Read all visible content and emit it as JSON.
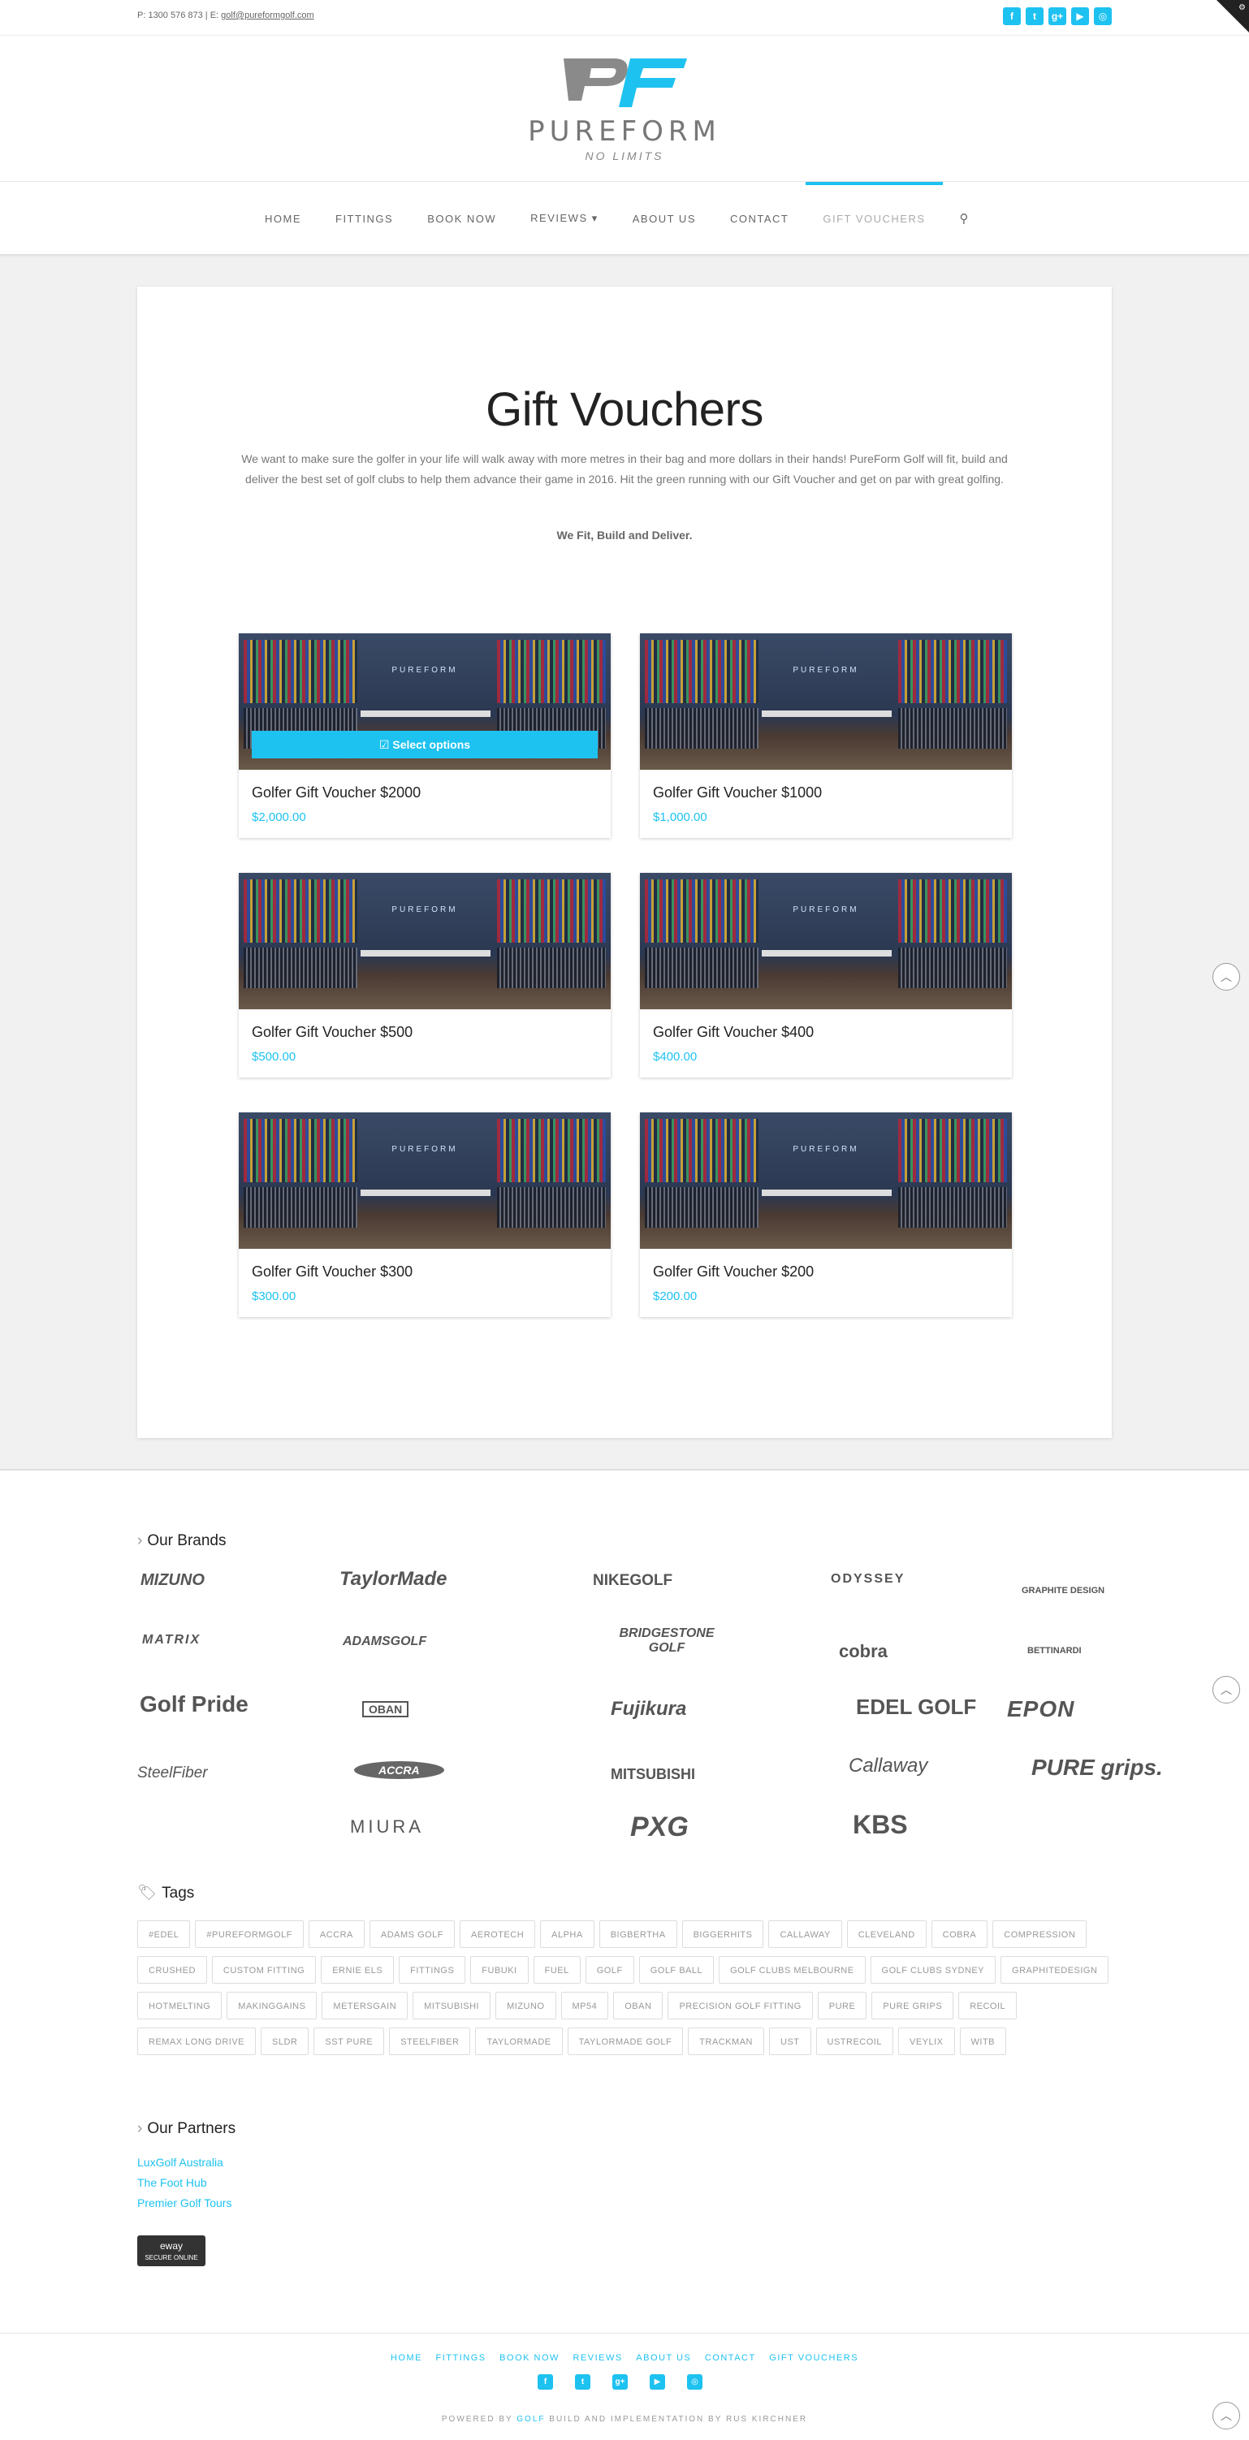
{
  "topbar": {
    "contact_phone": "P: 1300 576 873",
    "contact_sep": " | E: ",
    "contact_email": "golf@pureformgolf.com"
  },
  "logo": {
    "wordmark": "PUREFORM",
    "tagline": "NO LIMITS"
  },
  "nav": {
    "items": [
      "HOME",
      "FITTINGS",
      "BOOK NOW",
      "REVIEWS ▾",
      "ABOUT US",
      "CONTACT",
      "GIFT VOUCHERS"
    ],
    "active": "GIFT VOUCHERS"
  },
  "page": {
    "title": "Gift Vouchers",
    "intro": "We want to make sure the golfer in your life will walk away with more metres in their bag and more dollars in their hands! PureForm Golf will fit, build and deliver the best set of golf clubs to help them advance their game in 2016. Hit the green running with our Gift Voucher and get on par with great golfing.",
    "motto": "We Fit, Build and Deliver."
  },
  "products": [
    {
      "name": "Golfer Gift Voucher $2000",
      "price": "$2,000.00",
      "button": "Select options"
    },
    {
      "name": "Golfer Gift Voucher $1000",
      "price": "$1,000.00"
    },
    {
      "name": "Golfer Gift Voucher $500",
      "price": "$500.00"
    },
    {
      "name": "Golfer Gift Voucher $400",
      "price": "$400.00"
    },
    {
      "name": "Golfer Gift Voucher $300",
      "price": "$300.00"
    },
    {
      "name": "Golfer Gift Voucher $200",
      "price": "$200.00"
    }
  ],
  "product_image_logo": "PUREFORM",
  "brands_title": "Our Brands",
  "brands": [
    "MIZUNO",
    "TaylorMade",
    "NIKEGOLF",
    "ODYSSEY",
    "GRAPHITE DESIGN",
    "MATRIX",
    "ADAMSGOLF",
    "BRIDGESTONE GOLF",
    "cobra",
    "BETTINARDI",
    "Golf Pride",
    "OBAN",
    "Fujikura",
    "EDEL GOLF",
    "EPON",
    "SteelFiber",
    "ACCRA",
    "MITSUBISHI",
    "Callaway",
    "PURE grips.",
    "MIURA",
    "PXG",
    "KBS"
  ],
  "tags_title": "Tags",
  "tags": [
    "#EDEL",
    "#PUREFORMGOLF",
    "ACCRA",
    "ADAMS GOLF",
    "AEROTECH",
    "ALPHA",
    "BIGBERTHA",
    "BIGGERHITS",
    "CALLAWAY",
    "CLEVELAND",
    "COBRA",
    "COMPRESSION",
    "CRUSHED",
    "CUSTOM FITTING",
    "ERNIE ELS",
    "FITTINGS",
    "FUBUKI",
    "FUEL",
    "GOLF",
    "GOLF BALL",
    "GOLF CLUBS MELBOURNE",
    "GOLF CLUBS SYDNEY",
    "GRAPHITEDESIGN",
    "HOTMELTING",
    "MAKINGGAINS",
    "METERSGAIN",
    "MITSUBISHI",
    "MIZUNO",
    "MP54",
    "OBAN",
    "PRECISION GOLF FITTING",
    "PURE",
    "PURE GRIPS",
    "RECOIL",
    "REMAX LONG DRIVE",
    "SLDR",
    "SST PURE",
    "STEELFIBER",
    "TAYLORMADE",
    "TAYLORMADE GOLF",
    "TRACKMAN",
    "UST",
    "USTRECOIL",
    "VEYLIX",
    "WITB"
  ],
  "partners_title": "Our Partners",
  "partners": [
    "LuxGolf Australia",
    "The Foot Hub",
    "Premier Golf Tours"
  ],
  "eway": {
    "brand": "eway",
    "label": "SECURE ONLINE"
  },
  "footer": {
    "links": [
      "HOME",
      "FITTINGS",
      "BOOK NOW",
      "REVIEWS",
      "ABOUT US",
      "CONTACT",
      "GIFT VOUCHERS"
    ],
    "credit_prefix": "POWERED BY ",
    "credit_brand": "GOLF",
    "credit_suffix": " BUILD AND IMPLEMENTATION BY RUS KIRCHNER"
  },
  "colors": {
    "accent": "#1ec2f0",
    "text": "#666666",
    "background": "#f1f1f1"
  }
}
